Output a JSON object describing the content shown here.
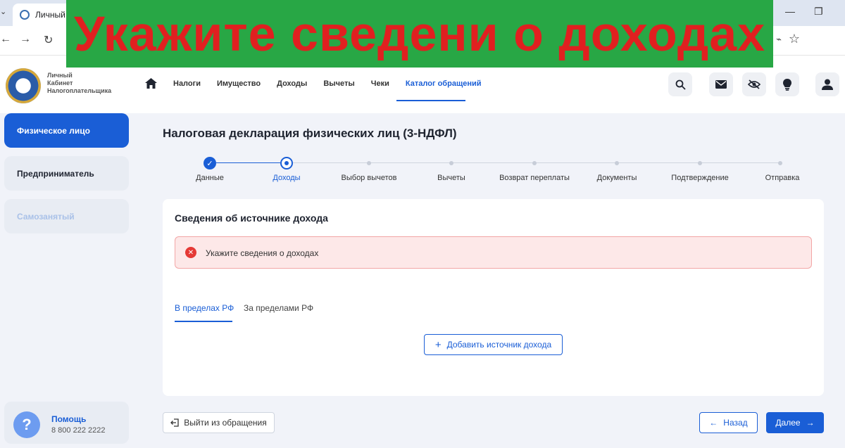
{
  "browser": {
    "tab_title": "Личный к",
    "tab_chevron": "⌄",
    "back": "←",
    "forward": "→",
    "reload": "↻",
    "bookmark": "☆",
    "extension": "⌁",
    "restore": "❐",
    "minimize": "—"
  },
  "banner": {
    "text": "Укажите сведени о доходах",
    "bg_color": "#28a745",
    "text_color": "#e02020"
  },
  "header": {
    "logo_lines": [
      "Личный",
      "Кабинет",
      "Налогоплательщика"
    ],
    "nav": [
      {
        "label": "Налоги"
      },
      {
        "label": "Имущество"
      },
      {
        "label": "Доходы"
      },
      {
        "label": "Вычеты"
      },
      {
        "label": "Чеки"
      },
      {
        "label": "Каталог обращений",
        "active": true
      }
    ],
    "icons": [
      "search-icon",
      "mail-icon",
      "eye-off-icon",
      "lightbulb-icon",
      "user-icon"
    ]
  },
  "sidebar": {
    "items": [
      {
        "label": "Физическое лицо",
        "state": "active"
      },
      {
        "label": "Предприниматель",
        "state": "normal"
      },
      {
        "label": "Самозанятый",
        "state": "disabled"
      }
    ],
    "help": {
      "symbol": "?",
      "title": "Помощь",
      "phone": "8 800 222 2222"
    }
  },
  "page": {
    "title": "Налоговая декларация физических лиц (3-НДФЛ)",
    "steps": [
      {
        "label": "Данные",
        "status": "done"
      },
      {
        "label": "Доходы",
        "status": "current"
      },
      {
        "label": "Выбор вычетов",
        "status": "pending"
      },
      {
        "label": "Вычеты",
        "status": "pending"
      },
      {
        "label": "Возврат переплаты",
        "status": "pending"
      },
      {
        "label": "Документы",
        "status": "pending"
      },
      {
        "label": "Подтверждение",
        "status": "pending"
      },
      {
        "label": "Отправка",
        "status": "pending"
      }
    ],
    "card": {
      "title": "Сведения об источнике дохода",
      "alert": "Укажите сведения о доходах",
      "tabs": [
        {
          "label": "В пределах РФ",
          "active": true
        },
        {
          "label": "За пределами РФ"
        }
      ],
      "add_button": "Добавить источник дохода"
    },
    "footer": {
      "exit": "Выйти из обращения",
      "back": "Назад",
      "next": "Далее"
    }
  },
  "colors": {
    "accent": "#1a5ed6",
    "alert_bg": "#fde8e8",
    "alert_icon": "#e53935"
  }
}
